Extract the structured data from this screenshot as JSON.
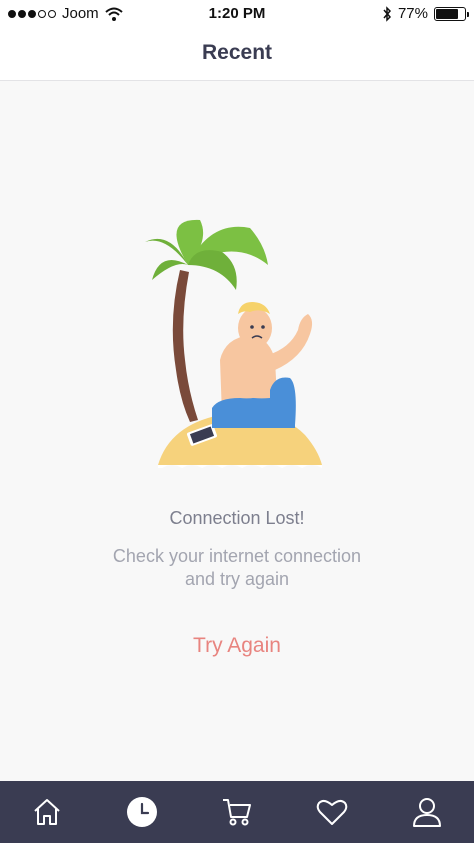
{
  "status_bar": {
    "carrier": "Joom",
    "time": "1:20 PM",
    "battery": "77%",
    "battery_level": 0.77
  },
  "header": {
    "title": "Recent"
  },
  "empty_state": {
    "title": "Connection Lost!",
    "message_line1": "Check your internet connection",
    "message_line2": "and try again",
    "action": "Try Again"
  },
  "tab_bar": {
    "tabs": [
      {
        "icon": "home-icon"
      },
      {
        "icon": "clock-icon",
        "active": true
      },
      {
        "icon": "cart-icon"
      },
      {
        "icon": "heart-icon"
      },
      {
        "icon": "profile-icon"
      }
    ]
  },
  "colors": {
    "accent": "#e8847f",
    "tab_bar_bg": "#3a3c52",
    "title": "#3a3c52",
    "background": "#f8f8f8"
  }
}
